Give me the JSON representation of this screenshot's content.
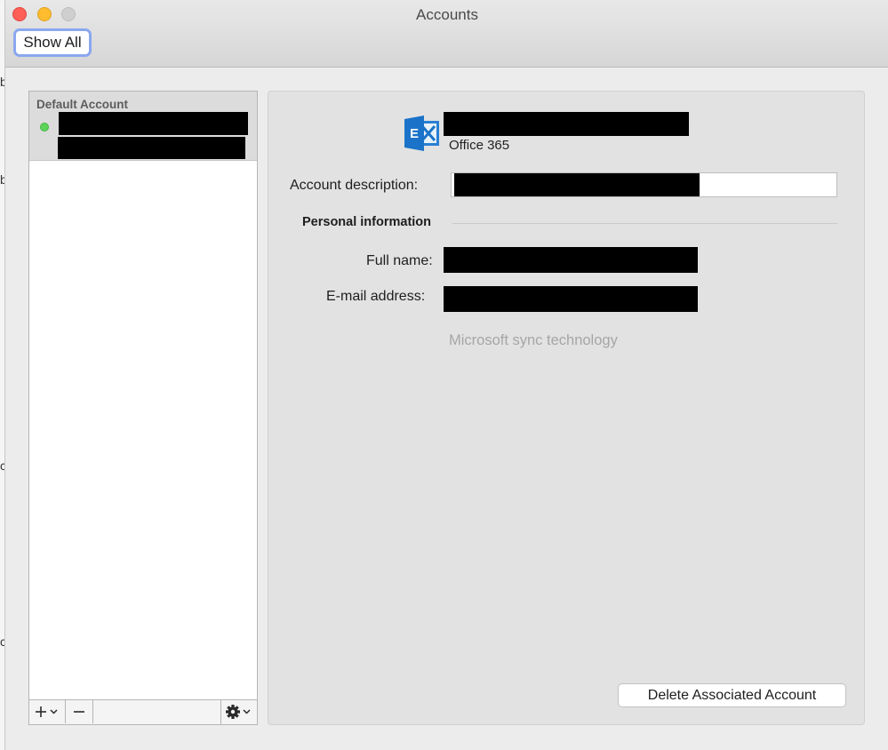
{
  "window": {
    "title": "Accounts",
    "show_all_label": "Show All"
  },
  "sidebar": {
    "default_heading": "Default Account",
    "account_status": "online",
    "toolbar": {
      "add_icon": "plus-icon",
      "remove_icon": "minus-icon",
      "actions_icon": "gear-icon"
    }
  },
  "detail": {
    "account_type": "Office 365",
    "description_label": "Account description:",
    "section_title": "Personal information",
    "full_name_label": "Full name:",
    "email_label": "E-mail address:",
    "sync_note": "Microsoft sync technology",
    "delete_label": "Delete Associated Account"
  },
  "colors": {
    "accent_focus": "#8aa8ef",
    "status_online": "#5dd35a",
    "exchange_blue": "#1a73c8"
  }
}
